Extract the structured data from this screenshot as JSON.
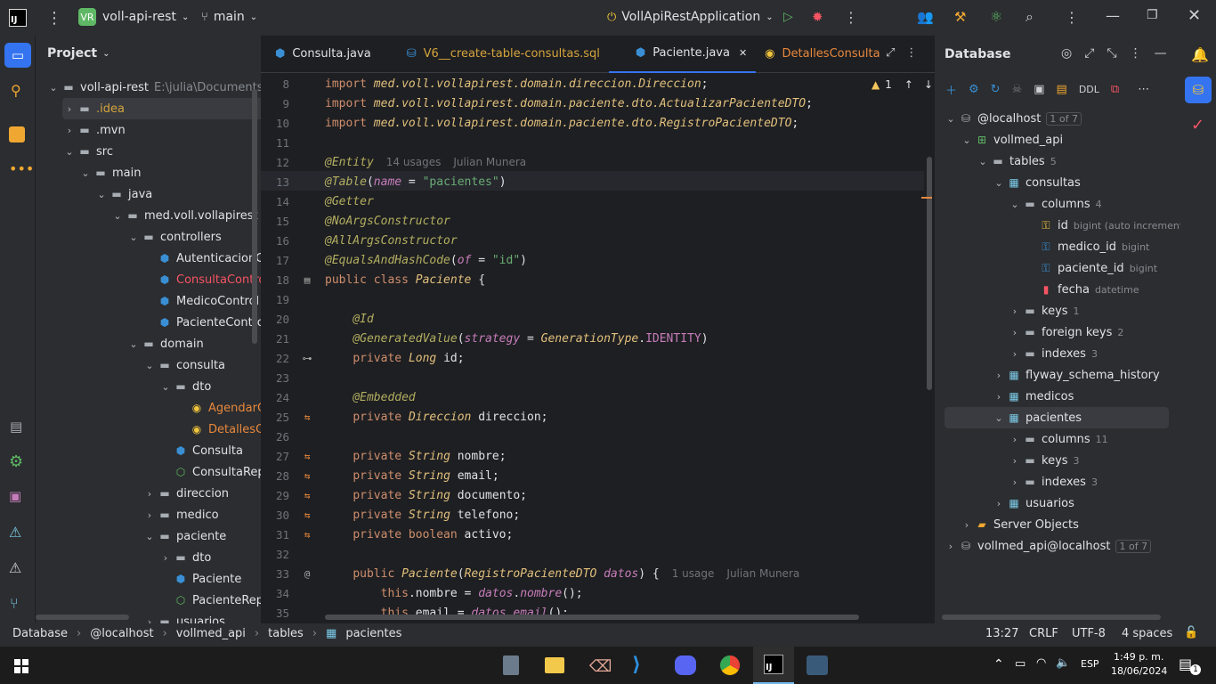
{
  "titlebar": {
    "logo": "IJ",
    "project_badge": "VR",
    "project_name": "voll-api-rest",
    "branch": "main",
    "run_config": "VollApiRestApplication"
  },
  "project_panel": {
    "title": "Project",
    "items": [
      {
        "label": "voll-api-rest",
        "extra": "E:\\julia\\Documents",
        "color": "#dfe1e5",
        "arrow": "⌄",
        "icon": "folder"
      },
      {
        "label": ".idea",
        "extra": "",
        "color": "#d5a43c",
        "arrow": "›",
        "icon": "folder"
      },
      {
        "label": ".mvn",
        "extra": "",
        "color": "#dfe1e5",
        "arrow": "›",
        "icon": "folder"
      },
      {
        "label": "src",
        "extra": "",
        "color": "#dfe1e5",
        "arrow": "⌄",
        "icon": "folder"
      },
      {
        "label": "main",
        "extra": "",
        "color": "#dfe1e5",
        "arrow": "⌄",
        "icon": "folder"
      },
      {
        "label": "java",
        "extra": "",
        "color": "#dfe1e5",
        "arrow": "⌄",
        "icon": "folder"
      },
      {
        "label": "med.voll.vollapirest",
        "extra": "",
        "color": "#dfe1e5",
        "arrow": "⌄",
        "icon": "folder"
      },
      {
        "label": "controllers",
        "extra": "",
        "color": "#dfe1e5",
        "arrow": "⌄",
        "icon": "folder"
      },
      {
        "label": "AutenticacionC",
        "extra": "",
        "color": "#dfe1e5",
        "arrow": "",
        "icon": "class"
      },
      {
        "label": "ConsultaContro",
        "extra": "",
        "color": "#f75464",
        "arrow": "",
        "icon": "class"
      },
      {
        "label": "MedicoControl",
        "extra": "",
        "color": "#dfe1e5",
        "arrow": "",
        "icon": "class"
      },
      {
        "label": "PacienteContro",
        "extra": "",
        "color": "#dfe1e5",
        "arrow": "",
        "icon": "class"
      },
      {
        "label": "domain",
        "extra": "",
        "color": "#dfe1e5",
        "arrow": "⌄",
        "icon": "folder"
      },
      {
        "label": "consulta",
        "extra": "",
        "color": "#dfe1e5",
        "arrow": "⌄",
        "icon": "folder"
      },
      {
        "label": "dto",
        "extra": "",
        "color": "#dfe1e5",
        "arrow": "⌄",
        "icon": "folder"
      },
      {
        "label": "AgendarC",
        "extra": "",
        "color": "#e8883d",
        "arrow": "",
        "icon": "record"
      },
      {
        "label": "DetallesC",
        "extra": "",
        "color": "#e8883d",
        "arrow": "",
        "icon": "record"
      },
      {
        "label": "Consulta",
        "extra": "",
        "color": "#dfe1e5",
        "arrow": "",
        "icon": "class"
      },
      {
        "label": "ConsultaRep",
        "extra": "",
        "color": "#dfe1e5",
        "arrow": "",
        "icon": "iface"
      },
      {
        "label": "direccion",
        "extra": "",
        "color": "#dfe1e5",
        "arrow": "›",
        "icon": "folder"
      },
      {
        "label": "medico",
        "extra": "",
        "color": "#dfe1e5",
        "arrow": "›",
        "icon": "folder"
      },
      {
        "label": "paciente",
        "extra": "",
        "color": "#dfe1e5",
        "arrow": "⌄",
        "icon": "folder"
      },
      {
        "label": "dto",
        "extra": "",
        "color": "#dfe1e5",
        "arrow": "›",
        "icon": "folder"
      },
      {
        "label": "Paciente",
        "extra": "",
        "color": "#dfe1e5",
        "arrow": "",
        "icon": "class"
      },
      {
        "label": "PacienteRep",
        "extra": "",
        "color": "#dfe1e5",
        "arrow": "",
        "icon": "iface"
      },
      {
        "label": "usuarios",
        "extra": "",
        "color": "#dfe1e5",
        "arrow": "›",
        "icon": "folder"
      }
    ]
  },
  "editor": {
    "tabs": [
      {
        "label": "Consulta.java",
        "color": "#dfe1e5",
        "icon": "class"
      },
      {
        "label": "V6__create-table-consultas.sql",
        "color": "#d5a43c",
        "icon": "sql"
      },
      {
        "label": "Paciente.java",
        "color": "#dfe1e5",
        "icon": "class",
        "active": true
      },
      {
        "label": "DetallesConsulta",
        "color": "#e8883d",
        "icon": "record"
      }
    ],
    "warnings": "1",
    "lines": [
      {
        "n": "8",
        "html": "<span class='kw'>import</span> <span class='it'>med.voll.vollapirest.domain.direccion.Direccion</span>;"
      },
      {
        "n": "9",
        "html": "<span class='kw'>import</span> <span class='it'>med.voll.vollapirest.domain.paciente.dto.ActualizarPacienteDTO</span>;"
      },
      {
        "n": "10",
        "html": "<span class='kw'>import</span> <span class='it'>med.voll.vollapirest.domain.paciente.dto.RegistroPacienteDTO</span>;"
      },
      {
        "n": "11",
        "html": ""
      },
      {
        "n": "12",
        "html": "<span class='ann'>@Entity</span><span class='hint'>14 usages</span><span class='hint'>Julian Munera</span>"
      },
      {
        "n": "13",
        "html": "<span class='ann'>@Table</span>(<span class='param'>name</span> = <span class='str'>\"pacientes\"</span>)"
      },
      {
        "n": "14",
        "html": "<span class='ann'>@Getter</span>"
      },
      {
        "n": "15",
        "html": "<span class='ann'>@NoArgsConstructor</span>"
      },
      {
        "n": "16",
        "html": "<span class='ann'>@AllArgsConstructor</span>"
      },
      {
        "n": "17",
        "html": "<span class='ann'>@EqualsAndHashCode</span>(<span class='param'>of</span> = <span class='str'>\"id\"</span>)"
      },
      {
        "n": "18",
        "html": "<span class='kw'>public class</span> <span class='it'>Paciente</span> {"
      },
      {
        "n": "19",
        "html": ""
      },
      {
        "n": "20",
        "html": "    <span class='ann'>@Id</span>"
      },
      {
        "n": "21",
        "html": "    <span class='ann'>@GeneratedValue</span>(<span class='param'>strategy</span> = <span class='it'>GenerationType</span>.<span class='fld'>IDENTITY</span>)"
      },
      {
        "n": "22",
        "html": "    <span class='kw'>private</span> <span class='it'>Long</span> id;"
      },
      {
        "n": "23",
        "html": ""
      },
      {
        "n": "24",
        "html": "    <span class='ann'>@Embedded</span>"
      },
      {
        "n": "25",
        "html": "    <span class='kw'>private</span> <span class='it'>Direccion</span> direccion;"
      },
      {
        "n": "26",
        "html": ""
      },
      {
        "n": "27",
        "html": "    <span class='kw'>private</span> <span class='it'>String</span> nombre;"
      },
      {
        "n": "28",
        "html": "    <span class='kw'>private</span> <span class='it'>String</span> email;"
      },
      {
        "n": "29",
        "html": "    <span class='kw'>private</span> <span class='it'>String</span> documento;"
      },
      {
        "n": "30",
        "html": "    <span class='kw'>private</span> <span class='it'>String</span> telefono;"
      },
      {
        "n": "31",
        "html": "    <span class='kw'>private boolean</span> activo;"
      },
      {
        "n": "32",
        "html": ""
      },
      {
        "n": "33",
        "html": "    <span class='kw'>public</span> <span class='it'>Paciente</span>(<span class='it'>RegistroPacienteDTO</span> <span class='param'>datos</span>) {<span class='hint'>1 usage</span><span class='hint'>Julian Munera</span>"
      },
      {
        "n": "34",
        "html": "        <span class='kw'>this</span>.nombre = <span class='param'>datos</span>.<span class='param'>nombre</span>();"
      },
      {
        "n": "35",
        "html": "        <span class='kw'>this</span>.email = <span class='param'>datos</span>.<span class='param'>email</span>();"
      }
    ]
  },
  "database": {
    "title": "Database",
    "ddl_label": "DDL",
    "items": [
      {
        "label": "@localhost",
        "extra": "1 of 7",
        "arrow": "⌄",
        "icon": "db"
      },
      {
        "label": "vollmed_api",
        "extra": "",
        "arrow": "⌄",
        "icon": "schema"
      },
      {
        "label": "tables",
        "extra": "5",
        "arrow": "⌄",
        "icon": "folder"
      },
      {
        "label": "consultas",
        "extra": "",
        "arrow": "⌄",
        "icon": "table"
      },
      {
        "label": "columns",
        "extra": "4",
        "arrow": "⌄",
        "icon": "folder"
      },
      {
        "label": "id",
        "extra": "bigint (auto increment)",
        "arrow": "",
        "icon": "key"
      },
      {
        "label": "medico_id",
        "extra": "bigint",
        "arrow": "",
        "icon": "fkey"
      },
      {
        "label": "paciente_id",
        "extra": "bigint",
        "arrow": "",
        "icon": "fkey"
      },
      {
        "label": "fecha",
        "extra": "datetime",
        "arrow": "",
        "icon": "col"
      },
      {
        "label": "keys",
        "extra": "1",
        "arrow": "›",
        "icon": "folder"
      },
      {
        "label": "foreign keys",
        "extra": "2",
        "arrow": "›",
        "icon": "folder"
      },
      {
        "label": "indexes",
        "extra": "3",
        "arrow": "›",
        "icon": "folder"
      },
      {
        "label": "flyway_schema_history",
        "extra": "",
        "arrow": "›",
        "icon": "table"
      },
      {
        "label": "medicos",
        "extra": "",
        "arrow": "›",
        "icon": "table"
      },
      {
        "label": "pacientes",
        "extra": "",
        "arrow": "⌄",
        "icon": "table"
      },
      {
        "label": "columns",
        "extra": "11",
        "arrow": "›",
        "icon": "folder"
      },
      {
        "label": "keys",
        "extra": "3",
        "arrow": "›",
        "icon": "folder"
      },
      {
        "label": "indexes",
        "extra": "3",
        "arrow": "›",
        "icon": "folder"
      },
      {
        "label": "usuarios",
        "extra": "",
        "arrow": "›",
        "icon": "table"
      },
      {
        "label": "Server Objects",
        "extra": "",
        "arrow": "›",
        "icon": "server"
      },
      {
        "label": "vollmed_api@localhost",
        "extra": "1 of 7",
        "arrow": "›",
        "icon": "db"
      }
    ]
  },
  "statusbar": {
    "crumbs": [
      "Database",
      "@localhost",
      "vollmed_api",
      "tables",
      "pacientes"
    ],
    "position": "13:27",
    "line_sep": "CRLF",
    "encoding": "UTF-8",
    "indent": "4 spaces"
  },
  "taskbar": {
    "lang": "ESP",
    "time": "1:49 p. m.",
    "date": "18/06/2024",
    "notif": "1"
  },
  "colors": {
    "accent": "#3574f0",
    "bg": "#1e1f22",
    "panel": "#2b2d30"
  }
}
